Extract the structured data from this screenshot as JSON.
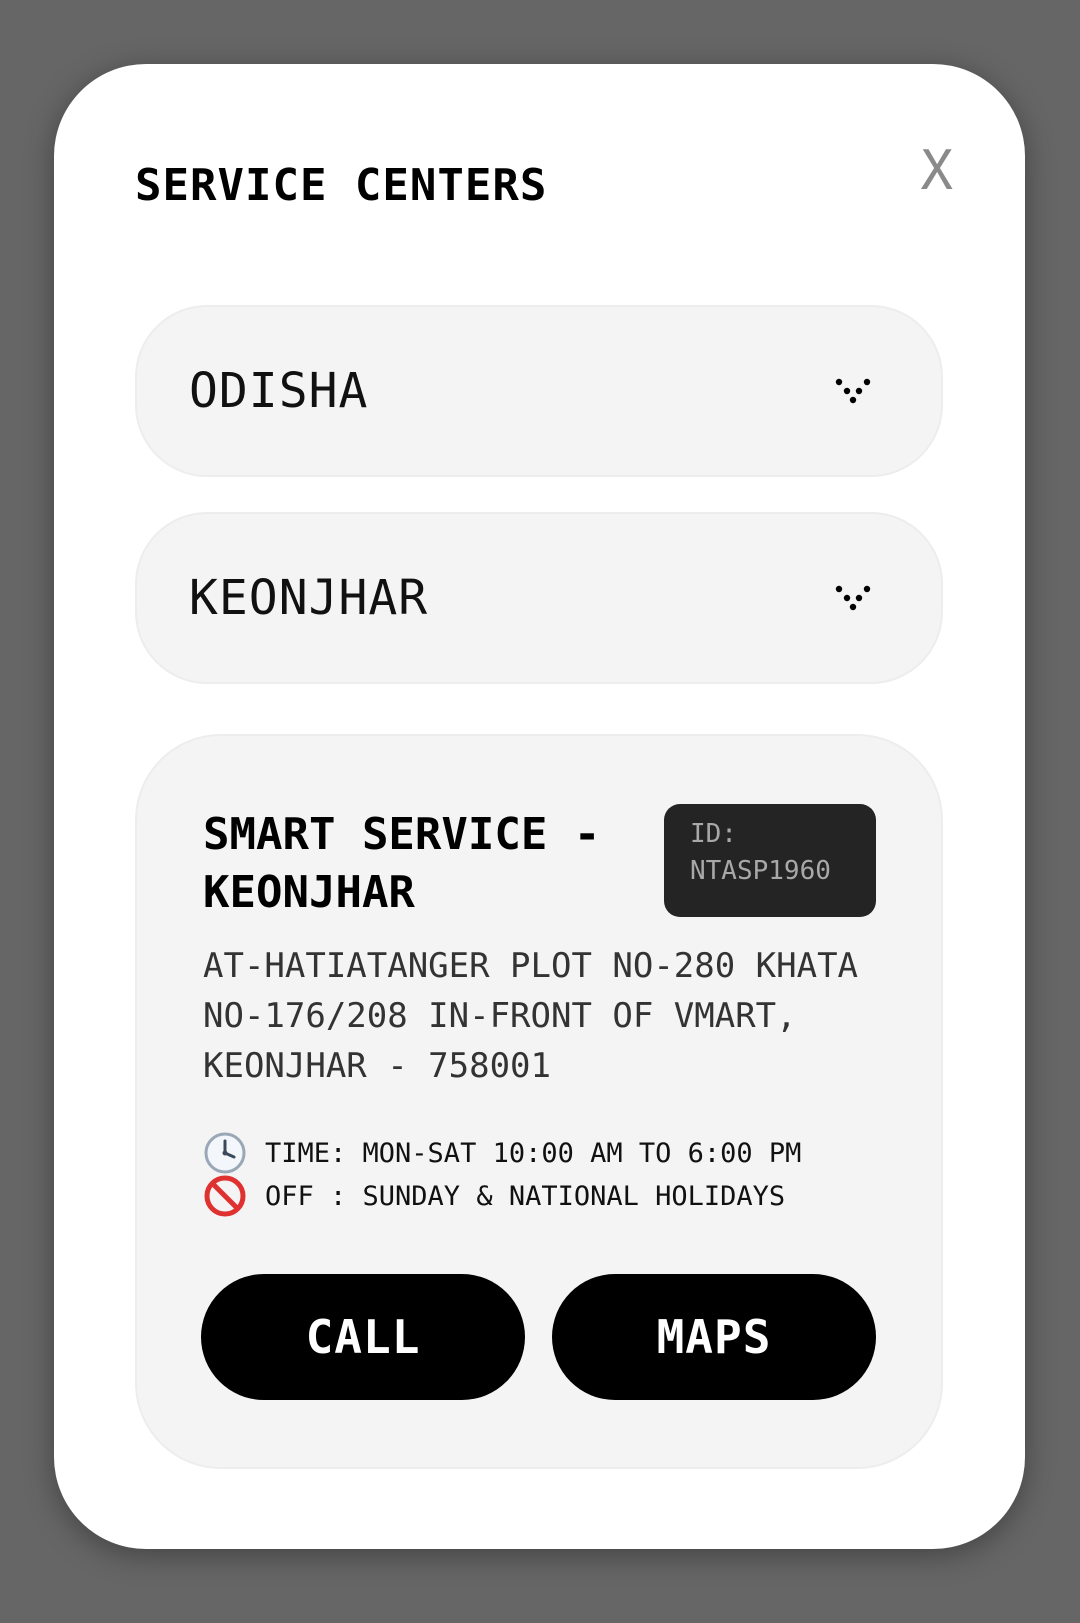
{
  "modal": {
    "title": "SERVICE CENTERS",
    "close_label": "X"
  },
  "filters": {
    "state": {
      "selected": "ODISHA",
      "icon": "chevron-down-icon"
    },
    "district": {
      "selected": "KEONJHAR",
      "icon": "chevron-down-icon"
    }
  },
  "center": {
    "name": "SMART SERVICE - KEONJHAR",
    "id_label": "ID:",
    "id_value": "NTASP1960",
    "address": "AT-HATIATANGER PLOT NO-280 KHATA NO-176/208 IN-FRONT OF VMART, KEONJHAR - 758001",
    "time_icon": "clock-icon",
    "time_text": "TIME: MON-SAT 10:00 AM TO 6:00 PM",
    "off_icon": "prohibited-icon",
    "off_text": "OFF : SUNDAY & NATIONAL HOLIDAYS",
    "call_label": "CALL",
    "maps_label": "MAPS"
  },
  "colors": {
    "backdrop": "#666666",
    "modal_bg": "#ffffff",
    "panel_bg": "#f4f4f4",
    "button_bg": "#000000",
    "badge_bg": "#242424",
    "prohibited_red": "#e03131"
  }
}
